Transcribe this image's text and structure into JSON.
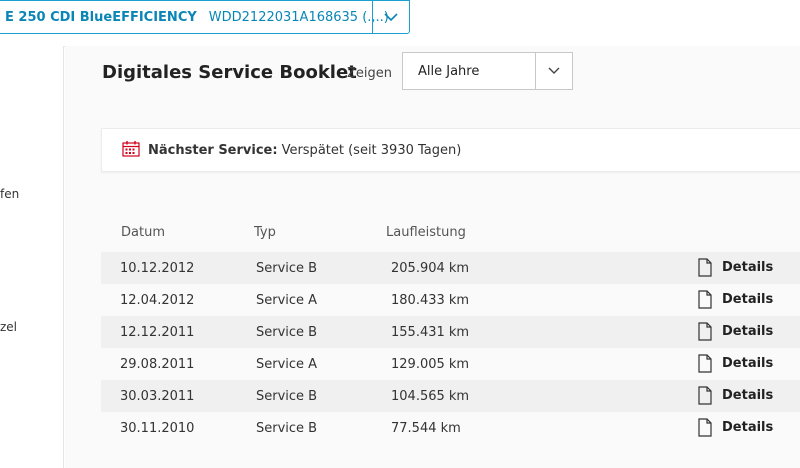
{
  "vehicle": {
    "model": "E 250 CDI BlueEFFICIENCY",
    "vin": "WDD2122031A168635 (.,..)"
  },
  "sidebar": {
    "items": [
      {
        "label": "fen"
      },
      {
        "label": "zel"
      }
    ]
  },
  "booklet": {
    "title": "Digitales Service Booklet",
    "show_label": "Zeigen",
    "filter_value": "Alle Jahre"
  },
  "next_service": {
    "label": "Nächster Service:",
    "status": "Verspätet (seit 3930 Tagen)"
  },
  "table": {
    "headers": {
      "date": "Datum",
      "type": "Typ",
      "mileage": "Laufleistung"
    },
    "details_label": "Details",
    "rows": [
      {
        "date": "10.12.2012",
        "type": "Service B",
        "mileage": "205.904 km"
      },
      {
        "date": "12.04.2012",
        "type": "Service A",
        "mileage": "180.433 km"
      },
      {
        "date": "12.12.2011",
        "type": "Service B",
        "mileage": "155.431 km"
      },
      {
        "date": "29.08.2011",
        "type": "Service A",
        "mileage": "129.005 km"
      },
      {
        "date": "30.03.2011",
        "type": "Service B",
        "mileage": "104.565 km"
      },
      {
        "date": "30.11.2010",
        "type": "Service B",
        "mileage": "77.544 km"
      }
    ]
  },
  "icons": {
    "vehicle_dropdown": "chevron-down-icon",
    "year_dropdown": "chevron-down-icon",
    "next_service": "calendar-icon",
    "details": "document-icon"
  },
  "colors": {
    "accent": "#0a86b6",
    "border_accent": "#1ba1d1",
    "calendar": "#d0021b"
  }
}
